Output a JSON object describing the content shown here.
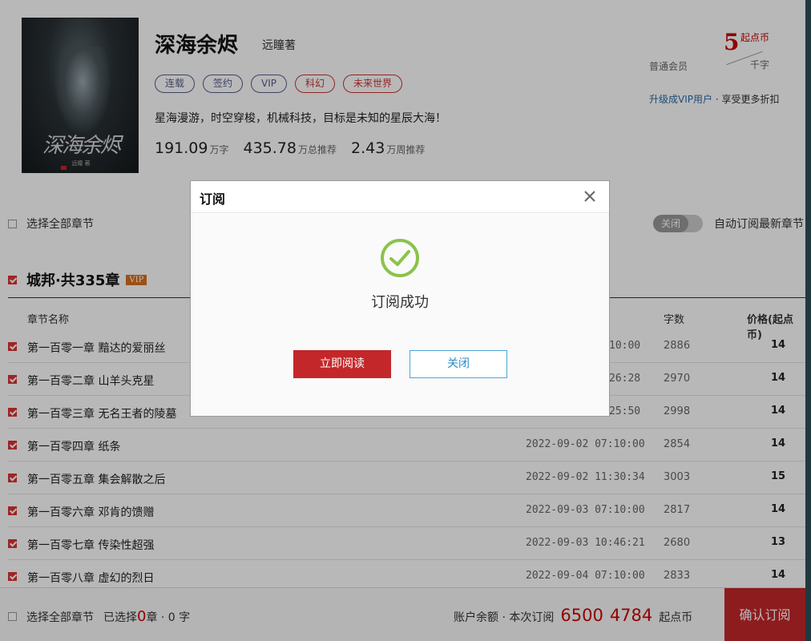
{
  "book": {
    "title": "深海余烬",
    "author": "远瞳著",
    "cover_title": "深海余烬",
    "cover_author": "远瞳 著",
    "tags": [
      "连载",
      "签约",
      "VIP",
      "科幻",
      "未来世界"
    ],
    "description": "星海漫游，时空穿梭，机械科技，目标是未知的星辰大海！",
    "stats": [
      {
        "value": "191.09",
        "unit": "万字"
      },
      {
        "value": "435.78",
        "unit": "万总推荐"
      },
      {
        "value": "2.43",
        "unit": "万周推荐"
      }
    ]
  },
  "pricing": {
    "price": "5",
    "unit": "起点币",
    "per": "千字",
    "member": "普通会员",
    "vip_link": "升级成VIP用户",
    "vip_promo": " · 享受更多折扣"
  },
  "controls": {
    "select_all": "选择全部章节",
    "toggle_label": "关闭",
    "auto_subscribe": "自动订阅最新章节"
  },
  "volume": {
    "title": "城邦·共335章",
    "badge": "VIP"
  },
  "table": {
    "headers": {
      "name": "章节名称",
      "words": "字数",
      "price": "价格(起点币)"
    },
    "rows": [
      {
        "name": "第一百零一章  黯达的爱丽丝",
        "time": "10:00",
        "words": "2886",
        "price": "14"
      },
      {
        "name": "第一百零二章  山羊头克星",
        "time": "26:28",
        "words": "2970",
        "price": "14"
      },
      {
        "name": "第一百零三章  无名王者的陵墓",
        "time": "25:50",
        "words": "2998",
        "price": "14"
      },
      {
        "name": "第一百零四章  纸条",
        "time": "2022-09-02 07:10:00",
        "words": "2854",
        "price": "14"
      },
      {
        "name": "第一百零五章  集会解散之后",
        "time": "2022-09-02 11:30:34",
        "words": "3003",
        "price": "15"
      },
      {
        "name": "第一百零六章  邓肯的馈赠",
        "time": "2022-09-03 07:10:00",
        "words": "2817",
        "price": "14"
      },
      {
        "name": "第一百零七章  传染性超强",
        "time": "2022-09-03 10:46:21",
        "words": "2680",
        "price": "13"
      },
      {
        "name": "第一百零八章  虚幻的烈日",
        "time": "2022-09-04 07:10:00",
        "words": "2833",
        "price": "14"
      }
    ]
  },
  "footer": {
    "select_all": "选择全部章节",
    "selected_prefix": "已选择",
    "selected_count": "0",
    "selected_suffix": "章 · 0 字",
    "balance_label": "账户余额 ·  本次订阅",
    "balance": "6500",
    "cost": "4784",
    "currency": "起点币",
    "confirm": "确认订阅"
  },
  "modal": {
    "title": "订阅",
    "message": "订阅成功",
    "read_button": "立即阅读",
    "close_button": "关闭"
  },
  "colors": {
    "accent_red": "#c4272a",
    "success_green": "#8bc34a",
    "link_blue": "#2a6aa8"
  }
}
